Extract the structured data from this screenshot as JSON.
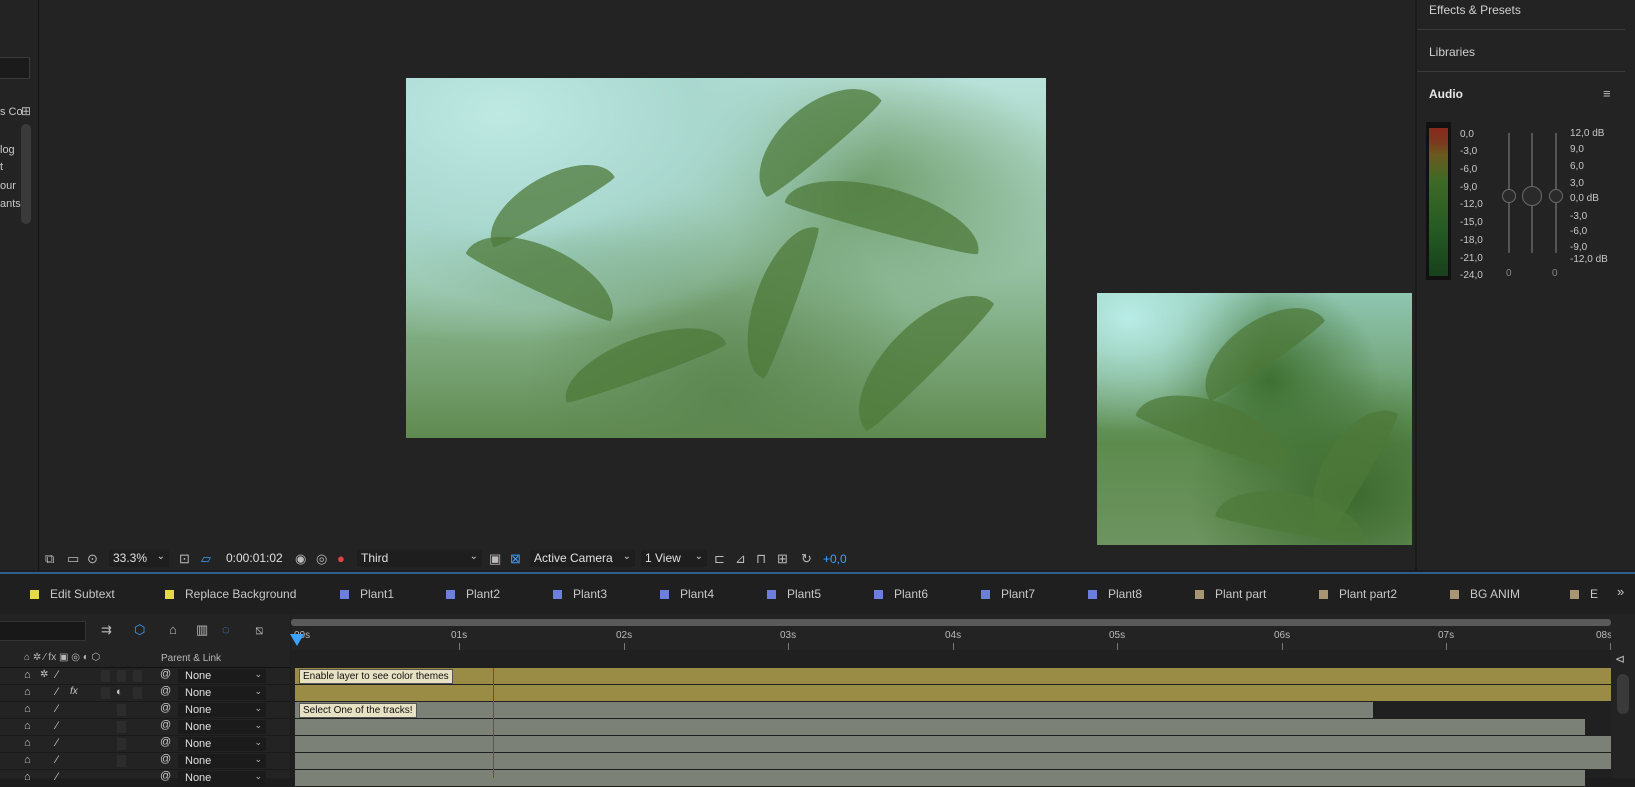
{
  "left_panel": {
    "labels": [
      "s Co",
      "log",
      "t",
      "our",
      "ants"
    ]
  },
  "viewer_toolbar": {
    "zoom": "33.3%",
    "timecode": "0:00:01:02",
    "resolution": "Third",
    "camera": "Active Camera",
    "views": "1 View",
    "exposure": "+0,0",
    "colors": {
      "exposure": "#3da1ff"
    }
  },
  "right_panel": {
    "effects_presets": "Effects & Presets",
    "libraries": "Libraries",
    "audio": "Audio",
    "meter_left_labels": [
      "0,0",
      "-3,0",
      "-6,0",
      "-9,0",
      "-12,0",
      "-15,0",
      "-18,0",
      "-21,0",
      "-24,0"
    ],
    "meter_right_labels": [
      "12,0 dB",
      "9,0",
      "6,0",
      "3,0",
      "0,0 dB",
      "-3,0",
      "-6,0",
      "-9,0",
      "-12,0 dB"
    ],
    "slider_values": [
      "0",
      "0"
    ]
  },
  "comp_tabs": [
    {
      "label": "Edit Subtext",
      "color": "#e5d84a"
    },
    {
      "label": "Replace Background",
      "color": "#e5d84a"
    },
    {
      "label": "Plant1",
      "color": "#6d7fdc"
    },
    {
      "label": "Plant2",
      "color": "#6d7fdc"
    },
    {
      "label": "Plant3",
      "color": "#6d7fdc"
    },
    {
      "label": "Plant4",
      "color": "#6d7fdc"
    },
    {
      "label": "Plant5",
      "color": "#6d7fdc"
    },
    {
      "label": "Plant6",
      "color": "#6d7fdc"
    },
    {
      "label": "Plant7",
      "color": "#6d7fdc"
    },
    {
      "label": "Plant8",
      "color": "#6d7fdc"
    },
    {
      "label": "Plant part",
      "color": "#a89672"
    },
    {
      "label": "Plant part2",
      "color": "#a89672"
    },
    {
      "label": "BG ANIM",
      "color": "#a89672"
    },
    {
      "label": "E",
      "color": "#a89672"
    }
  ],
  "timeline": {
    "parent_link_header": "Parent & Link",
    "ruler_labels": [
      "00s",
      "01s",
      "02s",
      "03s",
      "04s",
      "05s",
      "06s",
      "07s",
      "08s"
    ],
    "layers": [
      {
        "parent": "None",
        "note": "Enable layer to see color themes",
        "track_color": "#9b8c45"
      },
      {
        "parent": "None",
        "note": "",
        "track_color": "#9b8c45"
      },
      {
        "parent": "None",
        "note": "Select One of the tracks!",
        "track_color": "#7b8177"
      },
      {
        "parent": "None",
        "note": "",
        "track_color": "#7b8177"
      },
      {
        "parent": "None",
        "note": "",
        "track_color": "#7b8177"
      },
      {
        "parent": "None",
        "note": "",
        "track_color": "#7b8177"
      },
      {
        "parent": "None",
        "note": "",
        "track_color": "#7b8177"
      }
    ]
  }
}
